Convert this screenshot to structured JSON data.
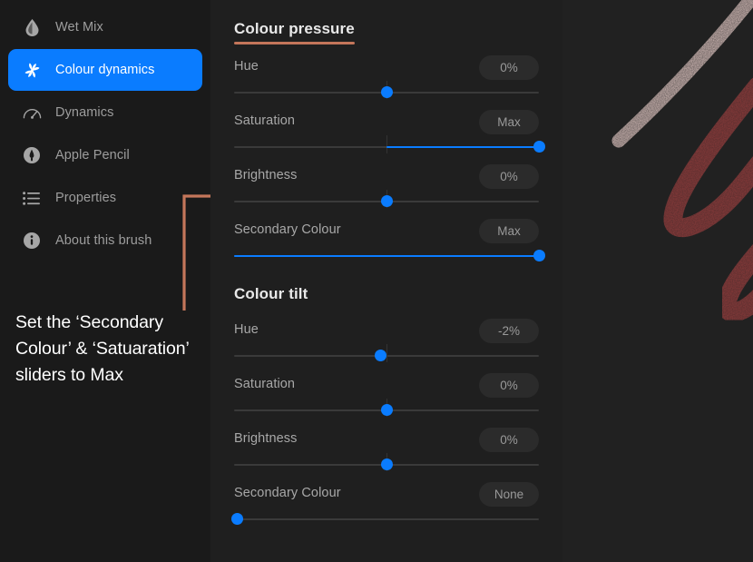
{
  "sidebar": {
    "items": [
      {
        "label": "Wet Mix",
        "icon": "droplet-icon",
        "active": false
      },
      {
        "label": "Colour dynamics",
        "icon": "pinwheel-icon",
        "active": true
      },
      {
        "label": "Dynamics",
        "icon": "speedometer-icon",
        "active": false
      },
      {
        "label": "Apple Pencil",
        "icon": "pencil-icon",
        "active": false
      },
      {
        "label": "Properties",
        "icon": "list-icon",
        "active": false
      },
      {
        "label": "About this brush",
        "icon": "info-icon",
        "active": false
      }
    ]
  },
  "annotation": {
    "text": "Set the ‘Secondary Colour’ & ‘Satuaration’ sliders to Max",
    "colour": "#c4765a",
    "bracket_name": "callout-bracket"
  },
  "colors": {
    "accent_blue": "#0a7cff",
    "accent_orange": "#c4765a",
    "panel_bg": "#1f1f1f",
    "sidebar_bg": "#1a1a1a",
    "track": "#3a3a3a",
    "badge_bg": "#2b2b2b"
  },
  "panel": {
    "sections": [
      {
        "title": "Colour pressure",
        "underlined": true,
        "rows": [
          {
            "label": "Hue",
            "value": "0%",
            "knob_pct": 50,
            "fill_from_pct": null,
            "fill_to_pct": null,
            "tick_pct": 50
          },
          {
            "label": "Saturation",
            "value": "Max",
            "knob_pct": 100,
            "fill_from_pct": 50,
            "fill_to_pct": 100,
            "tick_pct": 50
          },
          {
            "label": "Brightness",
            "value": "0%",
            "knob_pct": 50,
            "fill_from_pct": null,
            "fill_to_pct": null,
            "tick_pct": 50
          },
          {
            "label": "Secondary Colour",
            "value": "Max",
            "knob_pct": 100,
            "fill_from_pct": 0,
            "fill_to_pct": 100,
            "tick_pct": null
          }
        ]
      },
      {
        "title": "Colour tilt",
        "underlined": false,
        "rows": [
          {
            "label": "Hue",
            "value": "-2%",
            "knob_pct": 48,
            "fill_from_pct": null,
            "fill_to_pct": null,
            "tick_pct": 50
          },
          {
            "label": "Saturation",
            "value": "0%",
            "knob_pct": 50,
            "fill_from_pct": null,
            "fill_to_pct": null,
            "tick_pct": 50
          },
          {
            "label": "Brightness",
            "value": "0%",
            "knob_pct": 50,
            "fill_from_pct": null,
            "fill_to_pct": null,
            "tick_pct": 50
          },
          {
            "label": "Secondary Colour",
            "value": "None",
            "knob_pct": 0,
            "fill_from_pct": null,
            "fill_to_pct": null,
            "tick_pct": null
          }
        ]
      }
    ]
  },
  "canvas": {
    "name": "brush-stroke-preview",
    "strokes": [
      {
        "name": "pale-pink-stroke",
        "colour": "#d8bdb9"
      },
      {
        "name": "dark-red-loop-upper",
        "colour": "#8e3b3b"
      },
      {
        "name": "dark-red-loop-lower",
        "colour": "#8e3b3b"
      }
    ]
  }
}
